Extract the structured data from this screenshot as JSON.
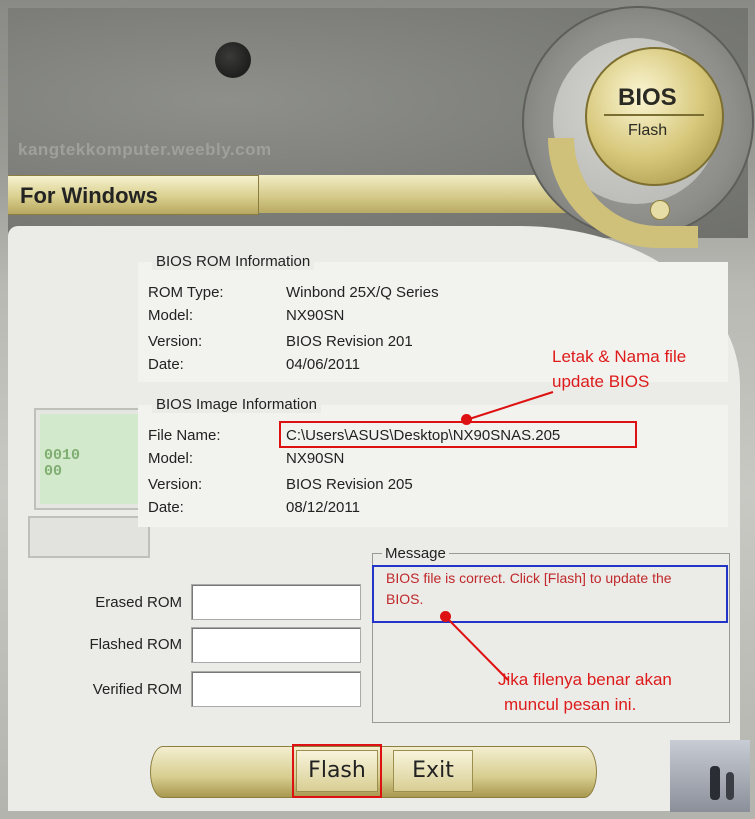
{
  "watermark": "kangtekkomputer.weebly.com",
  "banner": {
    "label": "For Windows"
  },
  "logo": {
    "title": "BIOS",
    "subtitle": "Flash"
  },
  "rom_info": {
    "section": "BIOS ROM Information",
    "rows": [
      {
        "label": "ROM Type:",
        "value": "Winbond 25X/Q Series"
      },
      {
        "label": "Model:",
        "value": "NX90SN"
      },
      {
        "label": "Version:",
        "value": "BIOS Revision 201"
      },
      {
        "label": "Date:",
        "value": "04/06/2011"
      }
    ]
  },
  "image_info": {
    "section": "BIOS Image Information",
    "rows": [
      {
        "label": "File Name:",
        "value": "C:\\Users\\ASUS\\Desktop\\NX90SNAS.205"
      },
      {
        "label": "Model:",
        "value": "NX90SN"
      },
      {
        "label": "Version:",
        "value": "BIOS Revision 205"
      },
      {
        "label": "Date:",
        "value": "08/12/2011"
      }
    ]
  },
  "progress": {
    "erased": {
      "label": "Erased ROM",
      "value": ""
    },
    "flashed": {
      "label": "Flashed ROM",
      "value": ""
    },
    "verified": {
      "label": "Verified ROM",
      "value": ""
    }
  },
  "message": {
    "legend": "Message",
    "text": "BIOS file is correct. Click [Flash] to update the BIOS."
  },
  "annotations": {
    "file_note_line1": "Letak & Nama file",
    "file_note_line2": "update BIOS",
    "msg_note_line1": "Jika filenya benar akan",
    "msg_note_line2": "muncul pesan ini."
  },
  "buttons": {
    "flash": "Flash",
    "exit": "Exit"
  },
  "colors": {
    "annotation_red": "#dd1b1b",
    "highlight_blue": "#2235c8",
    "gold": "#d8cd8c",
    "message_text": "#c0282a"
  }
}
